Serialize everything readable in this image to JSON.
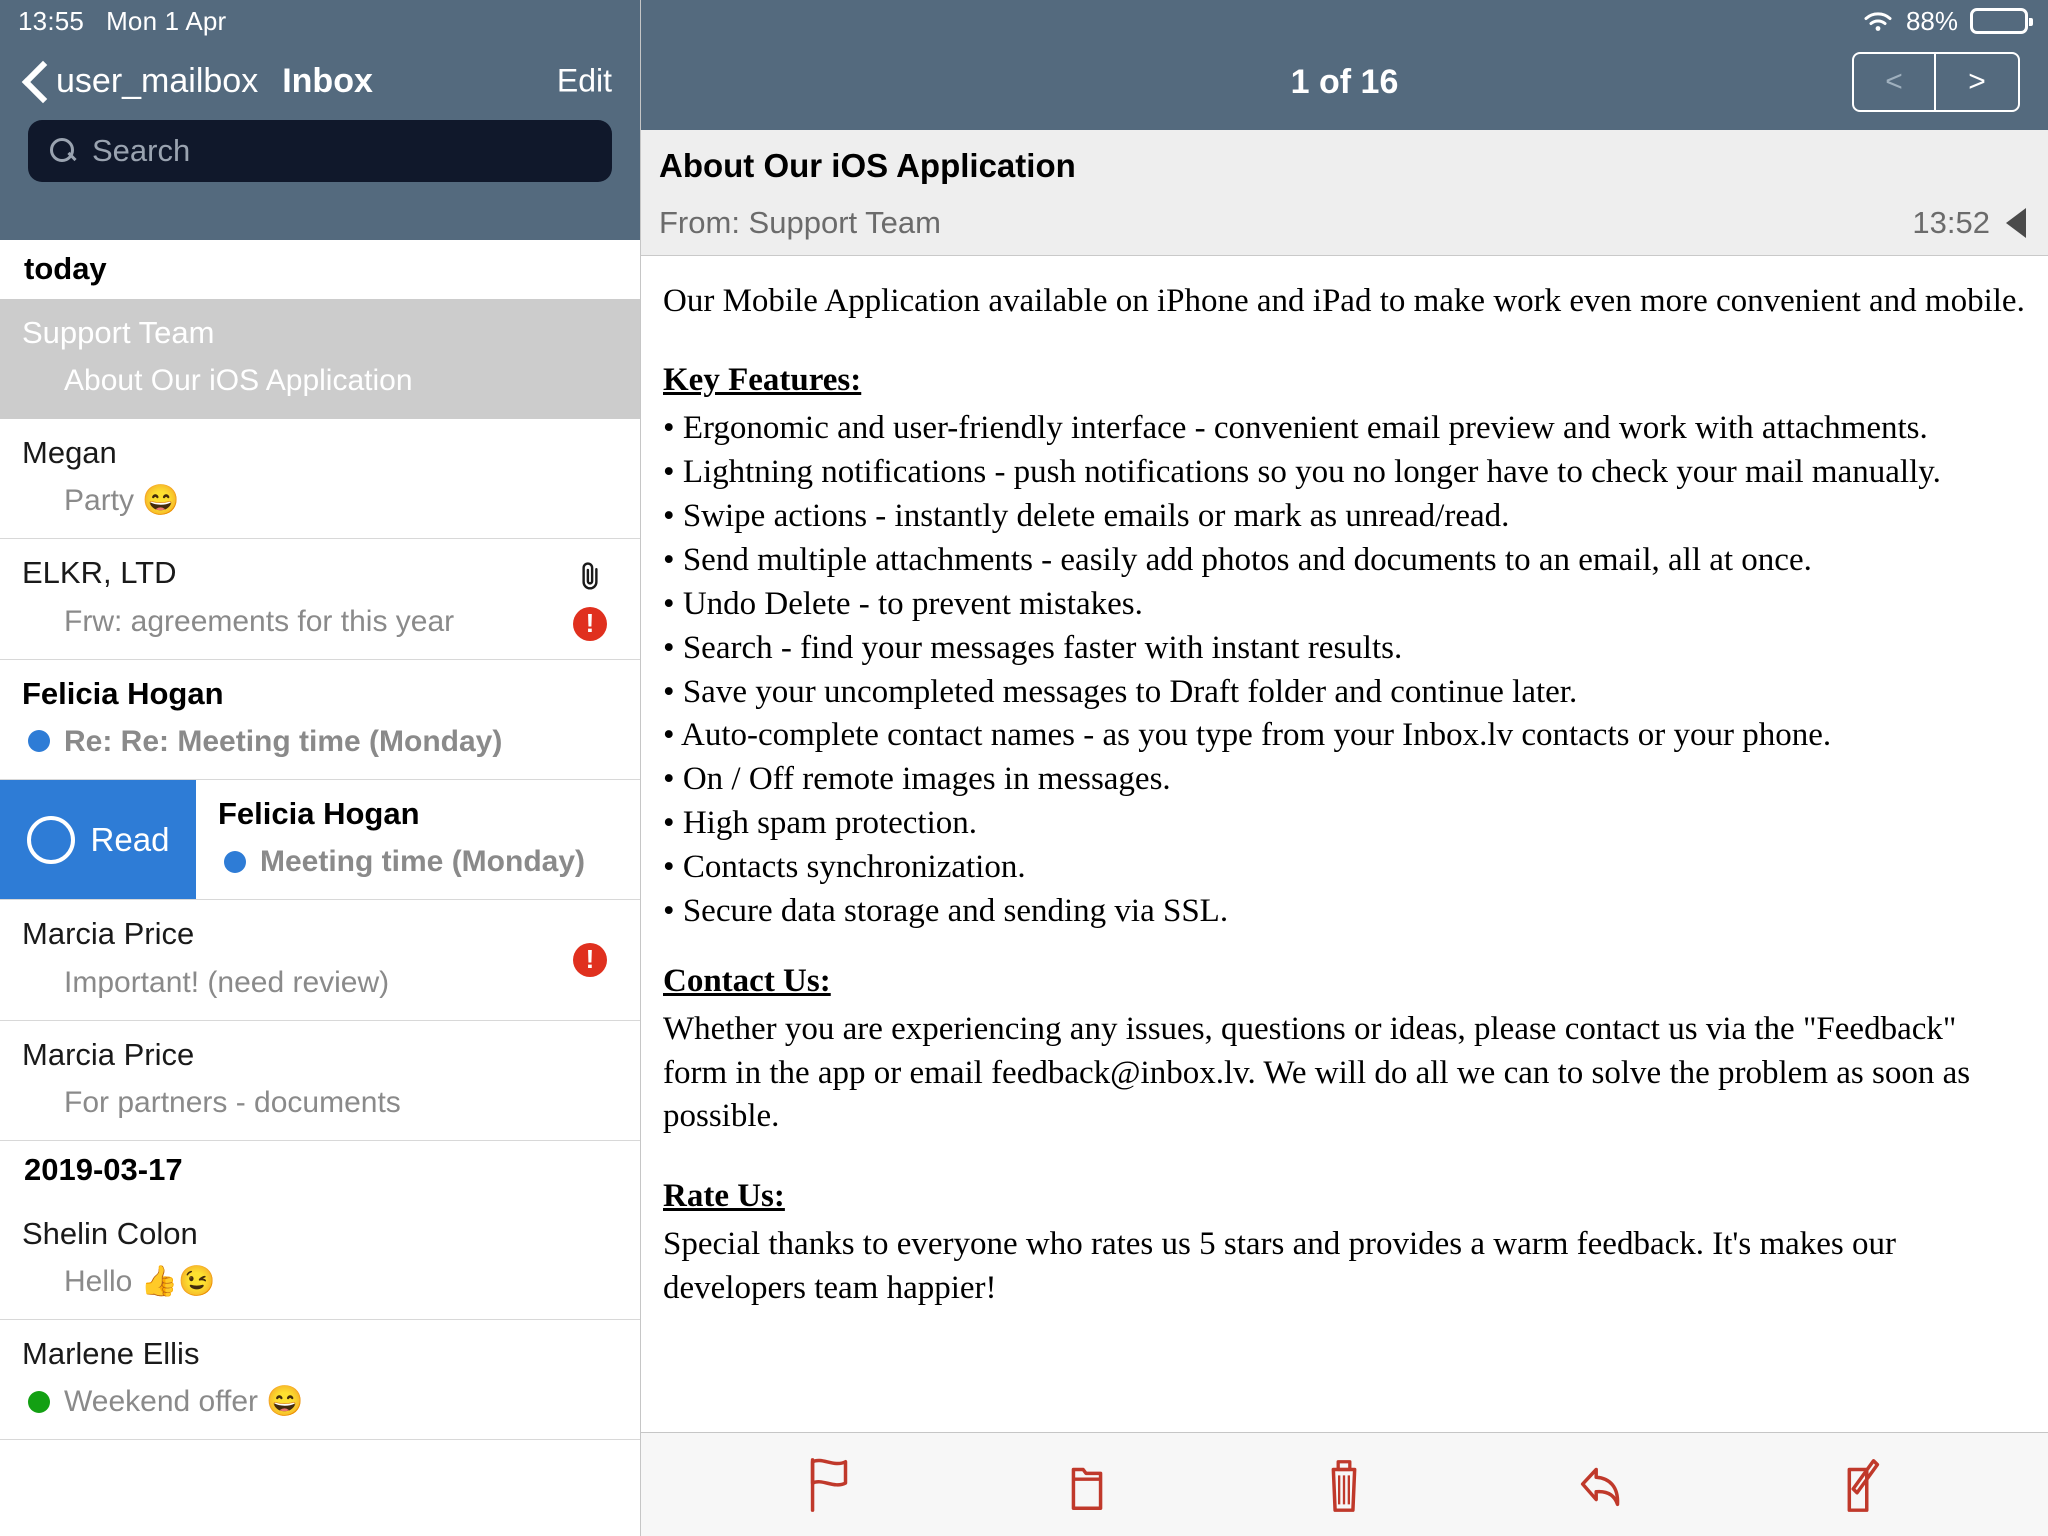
{
  "status_bar": {
    "time": "13:55",
    "date": "Mon 1 Apr",
    "battery_percent": "88%",
    "wifi_icon": "wifi-icon",
    "battery_icon": "battery-icon"
  },
  "sidebar": {
    "back_label": "user_mailbox",
    "back_icon": "chevron-left-icon",
    "title": "Inbox",
    "edit_label": "Edit",
    "search": {
      "placeholder": "Search",
      "value": "",
      "icon": "search-icon"
    },
    "sections": [
      {
        "header": "today",
        "rows": [
          {
            "sender": "Support Team",
            "subject": "About Our iOS Application",
            "selected": true,
            "unread": false,
            "dot": null,
            "attachment": false,
            "flagged": false
          },
          {
            "sender": "Megan",
            "subject": "Party 😄",
            "selected": false,
            "unread": false,
            "dot": null,
            "attachment": false,
            "flagged": false
          },
          {
            "sender": "ELKR, LTD",
            "subject": "Frw: agreements for this year",
            "selected": false,
            "unread": false,
            "dot": null,
            "attachment": true,
            "flagged": true
          },
          {
            "sender": "Felicia Hogan",
            "subject": "Re: Re: Meeting time (Monday)",
            "selected": false,
            "unread": true,
            "dot": "blue",
            "attachment": false,
            "flagged": false
          },
          {
            "sender": "Felicia Hogan",
            "subject": "Meeting time (Monday)",
            "selected": false,
            "unread": true,
            "dot": "blue",
            "attachment": false,
            "flagged": false,
            "swipe_action": {
              "label": "Read",
              "icon": "circle-outline-icon"
            }
          },
          {
            "sender": "Marcia Price",
            "subject": "Important! (need review)",
            "selected": false,
            "unread": false,
            "dot": null,
            "attachment": false,
            "flagged": true
          },
          {
            "sender": "Marcia Price",
            "subject": "For partners - documents",
            "selected": false,
            "unread": false,
            "dot": null,
            "attachment": false,
            "flagged": false
          }
        ]
      },
      {
        "header": "2019-03-17",
        "rows": [
          {
            "sender": "Shelin Colon",
            "subject": "Hello 👍😉",
            "selected": false,
            "unread": false,
            "dot": null,
            "attachment": false,
            "flagged": false
          },
          {
            "sender": "Marlene    Ellis",
            "subject": "Weekend offer 😄",
            "selected": false,
            "unread": false,
            "dot": "green",
            "attachment": false,
            "flagged": false
          }
        ]
      }
    ]
  },
  "reader": {
    "counter": "1 of 16",
    "prev_label": "<",
    "next_label": ">",
    "subject": "About Our iOS Application",
    "from": "From: Support Team",
    "time": "13:52",
    "collapse_icon": "triangle-left-icon",
    "body": {
      "intro": "Our Mobile Application available on iPhone and iPad to make work even more convenient and mobile.",
      "features_heading": "Key Features:",
      "features": [
        "Ergonomic and user-friendly interface - convenient email preview and work with attachments.",
        "Lightning notifications - push notifications so you no longer have to check your mail manually.",
        "Swipe actions - instantly delete emails or mark as unread/read.",
        "Send multiple attachments - easily add photos and documents to an email, all at once.",
        "Undo Delete - to prevent mistakes.",
        "Search - find your messages faster with instant results.",
        "Save your uncompleted messages to Draft folder and continue later.",
        "Auto-complete contact names - as you type from your Inbox.lv contacts or your phone.",
        "On / Off remote images in messages.",
        "High spam protection.",
        "Contacts synchronization.",
        "Secure data storage and sending via SSL."
      ],
      "contact_heading": "Contact Us: ",
      "contact_text": "Whether you are experiencing any issues, questions or ideas, please contact us via the \"Feedback\" form in the app or email feedback@inbox.lv. We will do all we can to solve the problem as soon as possible.",
      "rate_heading": "Rate Us:",
      "rate_text": "Special thanks to everyone who rates us 5 stars and provides a warm feedback. It's makes our developers team happier!"
    }
  },
  "toolbar": {
    "buttons": [
      {
        "name": "flag-icon",
        "label": "Flag"
      },
      {
        "name": "folder-icon",
        "label": "Move to folder"
      },
      {
        "name": "trash-icon",
        "label": "Delete"
      },
      {
        "name": "reply-icon",
        "label": "Reply"
      },
      {
        "name": "compose-icon",
        "label": "Compose"
      }
    ]
  },
  "colors": {
    "header_bg": "#546a7e",
    "search_bg": "#10182b",
    "accent_blue": "#2e7cd6",
    "alert_red": "#e0301e",
    "toolbar_red": "#c0392b",
    "selected_row": "#cccccc"
  }
}
